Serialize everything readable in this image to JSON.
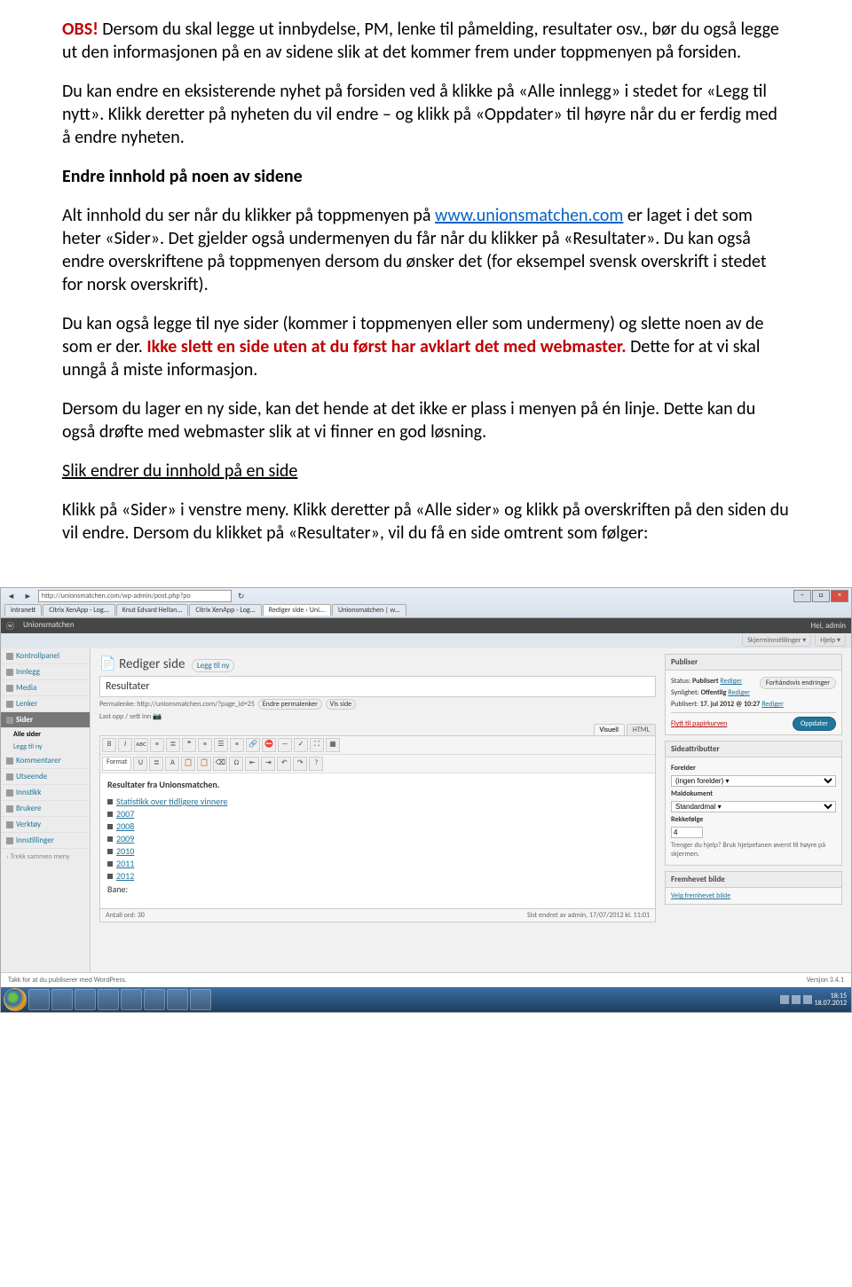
{
  "doc": {
    "p1_obs": "OBS!",
    "p1_rest": " Dersom du skal legge ut innbydelse, PM, lenke til påmelding, resultater osv., bør du også legge ut den informasjonen på en av sidene slik at det kommer frem under toppmenyen på forsiden.",
    "p2": "Du kan endre en eksisterende nyhet på forsiden ved å klikke på «Alle innlegg» i stedet for «Legg til nytt». Klikk deretter på nyheten du vil endre – og klikk på «Oppdater» til høyre når du er ferdig med å endre nyheten.",
    "h_endre": "Endre innhold på noen av sidene",
    "p3a": "Alt innhold du ser når du klikker på toppmenyen på ",
    "p3_link": "www.unionsmatchen.com",
    "p3b": " er laget i det som heter «Sider». Det gjelder også undermenyen du får når du klikker på «Resultater». Du kan også endre overskriftene på toppmenyen dersom du ønsker det (for eksempel svensk overskrift i stedet for norsk overskrift).",
    "p4a": "Du kan også legge til nye sider (kommer i toppmenyen eller som undermeny) og slette noen av de som er der. ",
    "p4_red": "Ikke slett en side uten at du først har avklart det med webmaster.",
    "p4b": " Dette for at vi skal unngå å miste informasjon.",
    "p5": "Dersom du lager en ny side, kan det hende at det ikke er plass i menyen på én linje. Dette kan du også drøfte med webmaster slik at vi finner en god løsning.",
    "p6": "Slik endrer du innhold på en side",
    "p7": "Klikk på «Sider» i venstre meny. Klikk deretter på «Alle sider» og klikk på overskriften på den siden du vil endre. Dersom du klikket på «Resultater», vil du få en side omtrent som følger:"
  },
  "ie": {
    "url": "http://unionsmatchen.com/wp-admin/post.php?po",
    "refresh": "↻",
    "tabs": [
      "intranett",
      "Citrix XenApp - Log...",
      "Knut Edvard Hellan...",
      "Citrix XenApp - Log...",
      "Rediger side ‹ Uni...",
      "Unionsmatchen | w..."
    ],
    "active_tab": 4
  },
  "adminbar": {
    "site": "Unionsmatchen",
    "greeting": "Hei, admin"
  },
  "screen_options": {
    "a": "Skjerminnstillinger ▾",
    "b": "Hjelp ▾"
  },
  "sidebar": {
    "items": [
      {
        "label": "Kontrollpanel"
      },
      {
        "label": "Innlegg"
      },
      {
        "label": "Media"
      },
      {
        "label": "Lenker"
      },
      {
        "label": "Sider",
        "active": true,
        "subs": [
          {
            "label": "Alle sider",
            "current": true
          },
          {
            "label": "Legg til ny"
          }
        ]
      },
      {
        "label": "Kommentarer"
      },
      {
        "label": "Utseende"
      },
      {
        "label": "Innstikk"
      },
      {
        "label": "Brukere"
      },
      {
        "label": "Verktøy"
      },
      {
        "label": "Innstillinger"
      }
    ],
    "collapse": "‹ Trekk sammen meny"
  },
  "editor": {
    "heading": "Rediger side",
    "addnew": "Legg til ny",
    "title": "Resultater",
    "permalink_label": "Permalenke:",
    "permalink_url": "http://unionsmatchen.com/?page_id=25",
    "btn_edit_perm": "Endre permalenker",
    "btn_view": "Vis side",
    "upload": "Last opp / sett inn",
    "tab_visual": "Visuell",
    "tab_html": "HTML",
    "format_sel": "Format",
    "content_title": "Resultater fra Unionsmatchen.",
    "list": [
      "Statistikk over tidligere vinnere",
      "2007",
      "2008",
      "2009",
      "2010",
      "2011",
      "2012"
    ],
    "bane": "Bane:",
    "words_label": "Antall ord:",
    "words": "30",
    "lastmod": "Sist endret av admin, 17/07/2012 kl. 11:01"
  },
  "publish": {
    "hdr": "Publiser",
    "preview": "Forhåndsvis endringer",
    "status_l": "Status:",
    "status_v": "Publisert",
    "status_edit": "Rediger",
    "vis_l": "Synlighet:",
    "vis_v": "Offentlig",
    "vis_edit": "Rediger",
    "pub_l": "Publisert:",
    "pub_v": "17. jul 2012 @ 10:27",
    "pub_edit": "Rediger",
    "trash": "Flytt til papirkurven",
    "update": "Oppdater"
  },
  "pageattr": {
    "hdr": "Sideattributter",
    "parent_l": "Forelder",
    "parent_v": "(ingen forelder) ▾",
    "tmpl_l": "Maldokument",
    "tmpl_v": "Standardmal ▾",
    "order_l": "Rekkefølge",
    "order_v": "4",
    "help": "Trenger du hjelp? Bruk hjelpefanen øverst til høyre på skjermen."
  },
  "featured": {
    "hdr": "Fremhevet bilde",
    "link": "Velg fremhevet bilde"
  },
  "wp_footer": {
    "thanks": "Takk for at du publiserer med WordPress.",
    "version": "Versjon 3.4.1"
  },
  "clock": {
    "time": "18:15",
    "date": "18.07.2012"
  }
}
